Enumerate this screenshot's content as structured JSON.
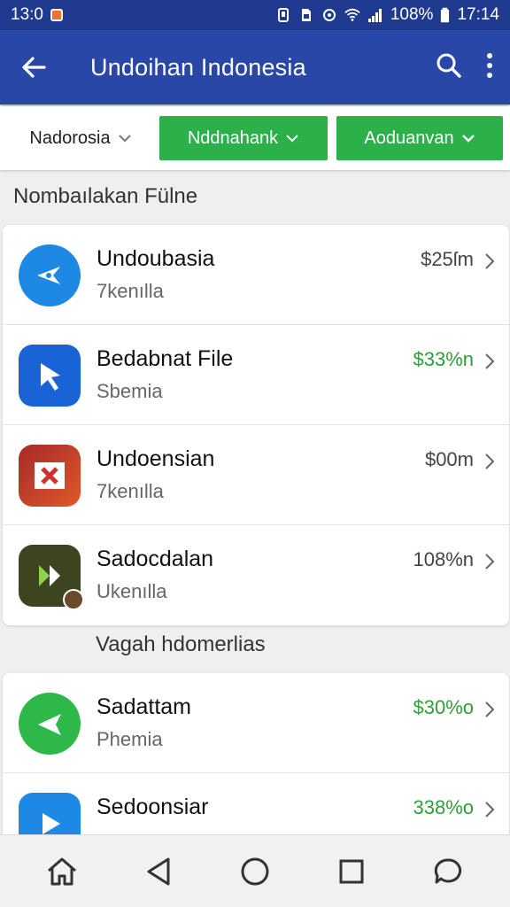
{
  "statusbar": {
    "time_left": "13:0",
    "battery": "108%",
    "time_right": "17:14"
  },
  "appbar": {
    "title": "Undoihan Indonesia",
    "back_icon": "arrow-left-icon",
    "search_icon": "search-icon",
    "more_icon": "more-vert-icon"
  },
  "filters": [
    {
      "label": "Nadorosia",
      "style": "plain"
    },
    {
      "label": "Nddnahank",
      "style": "green"
    },
    {
      "label": "Aoduanvan",
      "style": "green"
    }
  ],
  "sections": [
    {
      "title": "Nombaılakan Fülne",
      "items": [
        {
          "name": "Undoubasia",
          "sub": "7kenılla",
          "price": "$25ſm",
          "price_color": "#444444",
          "icon": "send-icon",
          "icon_bg": "#1e88e5"
        },
        {
          "name": "Bedabnat File",
          "sub": "Sbemia",
          "price": "$33%n",
          "price_color": "#2e9e3c",
          "icon": "cursor-icon",
          "icon_bg": "#1a63d6"
        },
        {
          "name": "Undoensian",
          "sub": "7kenılla",
          "price": "$00m",
          "price_color": "#444444",
          "icon": "close-box-icon",
          "icon_bg": "#c0392b"
        },
        {
          "name": "Sadocdalan",
          "sub": "Ukenılla",
          "price": "108%n",
          "price_color": "#444444",
          "icon": "play-forward-icon",
          "icon_bg": "#3c4420"
        }
      ]
    },
    {
      "title": "Vagah hdomerlias",
      "items": [
        {
          "name": "Sadattam",
          "sub": "Phemia",
          "price": "$30%o",
          "price_color": "#2e9e3c",
          "icon": "send-icon",
          "icon_bg": "#2fb84a"
        },
        {
          "name": "Sedoonsiar",
          "sub": "",
          "price": "338%o",
          "price_color": "#2e9e3c",
          "icon": "play-icon",
          "icon_bg": "#1e88e5"
        }
      ]
    }
  ],
  "navbar": {
    "icons": [
      "home-icon",
      "back-triangle-icon",
      "circle-home-icon",
      "square-recents-icon",
      "chat-icon"
    ]
  }
}
